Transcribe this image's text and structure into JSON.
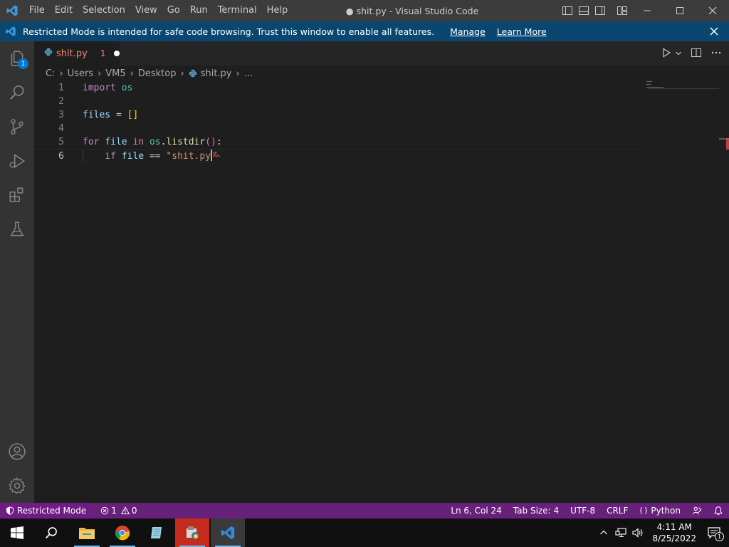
{
  "window": {
    "title": "● shit.py - Visual Studio Code",
    "menu": [
      "File",
      "Edit",
      "Selection",
      "View",
      "Go",
      "Run",
      "Terminal",
      "Help"
    ]
  },
  "banner": {
    "message": "Restricted Mode is intended for safe code browsing. Trust this window to enable all features.",
    "manage": "Manage",
    "learn_more": "Learn More"
  },
  "activity_bar": {
    "explorer_badge": "1"
  },
  "tab": {
    "name": "shit.py",
    "problems": "1"
  },
  "breadcrumbs": [
    "C:",
    "Users",
    "VM5",
    "Desktop",
    "shit.py",
    "..."
  ],
  "editor": {
    "line_numbers": [
      "1",
      "2",
      "3",
      "4",
      "5",
      "6"
    ],
    "lines": {
      "l1": {
        "kw": "import",
        "mod": "os"
      },
      "l3": {
        "var": "files",
        "op": "=",
        "bracket": "[]"
      },
      "l5": {
        "kw": "for",
        "var": "file",
        "kw2": "in",
        "mod": "os",
        "fn": "listdir",
        "paren": "()",
        "colon": ":"
      },
      "l6": {
        "indent": "    ",
        "kw": "if",
        "var": "file",
        "op": "==",
        "str_open": "\"shit.py",
        "str_close": "\""
      }
    }
  },
  "statusbar": {
    "restricted": "Restricted Mode",
    "errors": "1",
    "warnings": "0",
    "position": "Ln 6, Col 24",
    "tab_size": "Tab Size: 4",
    "encoding": "UTF-8",
    "eol": "CRLF",
    "language": "Python"
  },
  "taskbar": {
    "time": "4:11 AM",
    "date": "8/25/2022",
    "notifications": "1"
  },
  "colors": {
    "statusbar": "#68217a",
    "banner": "#094771",
    "activity_bar": "#333333",
    "editor_bg": "#1e1e1e",
    "error": "#f48771"
  }
}
